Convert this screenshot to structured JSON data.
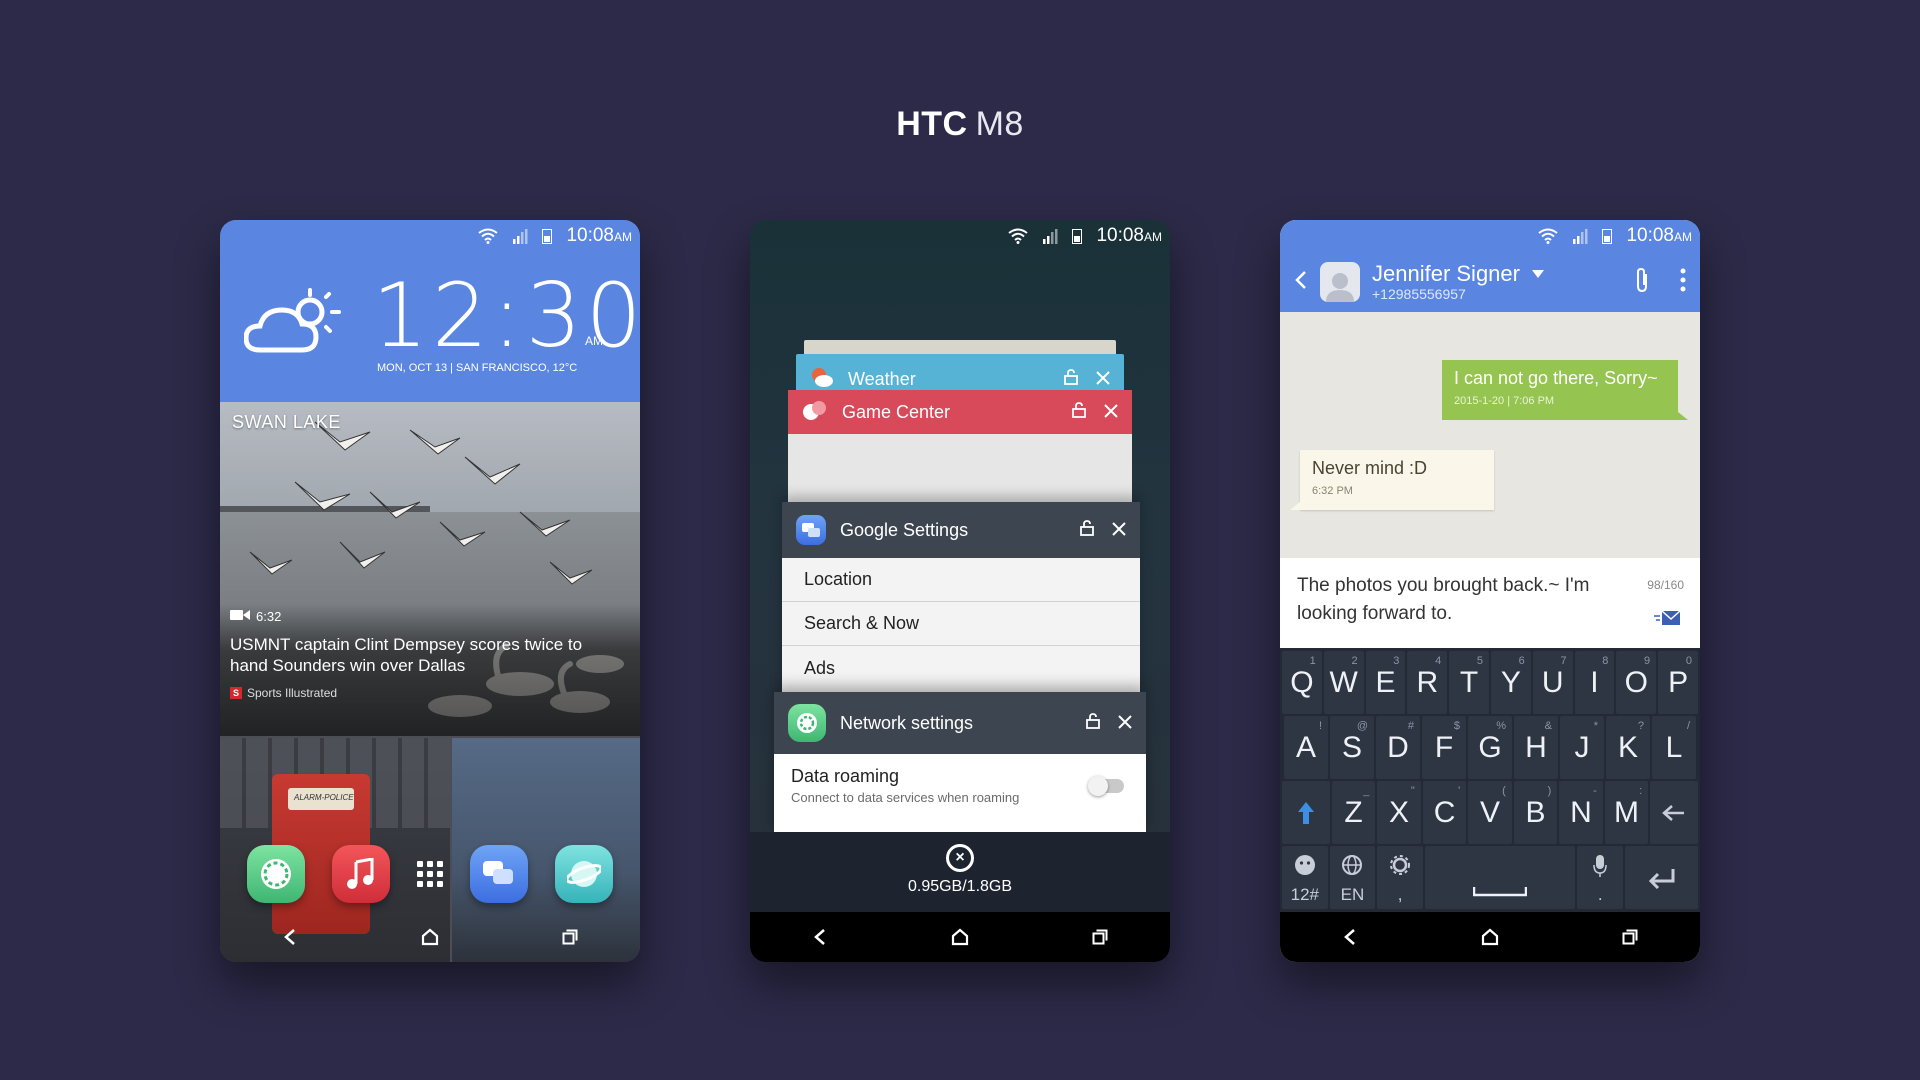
{
  "page": {
    "title_bold": "HTC",
    "title_light": "M8"
  },
  "status": {
    "time": "10:08",
    "ampm": "AM"
  },
  "phone1": {
    "clock": "12:30",
    "clock_ampm": "AM",
    "date_line": "MON, OCT 13 | SAN FRANCISCO, 12°C",
    "news_place": "SWAN LAKE",
    "video_duration": "6:32",
    "headline": "USMNT captain Clint Dempsey scores twice to hand Sounders win over Dallas",
    "source": "Sports Illustrated",
    "alarm_plate": "ALARM-POLICE",
    "dock_apps": [
      "phone-icon",
      "music-icon",
      "app-drawer-icon",
      "messages-icon",
      "browser-icon"
    ]
  },
  "phone2": {
    "cards": {
      "weather": "Weather",
      "game_center": "Game Center",
      "google_settings": "Google Settings",
      "google_items": [
        "Location",
        "Search & Now",
        "Ads"
      ],
      "network": "Network settings",
      "roaming_title": "Data roaming",
      "roaming_sub": "Connect to data services when roaming"
    },
    "roaming_enabled": false,
    "memory": "0.95GB/1.8GB"
  },
  "phone3": {
    "contact_name": "Jennifer Signer",
    "contact_number": "+12985556957",
    "outgoing_text": "I can not go there, Sorry~",
    "outgoing_meta": "2015-1-20  |  7:06 PM",
    "incoming_text": "Never mind  :D",
    "incoming_meta": "6:32 PM",
    "compose_text": "The photos you brought back.~    I'm looking forward to.",
    "char_count": "98/160",
    "keyboard": {
      "row1": [
        [
          "Q",
          "1"
        ],
        [
          "W",
          "2"
        ],
        [
          "E",
          "3"
        ],
        [
          "R",
          "4"
        ],
        [
          "T",
          "5"
        ],
        [
          "Y",
          "6"
        ],
        [
          "U",
          "7"
        ],
        [
          "I",
          "8"
        ],
        [
          "O",
          "9"
        ],
        [
          "P",
          "0"
        ]
      ],
      "row2": [
        [
          "A",
          "!"
        ],
        [
          "S",
          "@"
        ],
        [
          "D",
          "#"
        ],
        [
          "F",
          "$"
        ],
        [
          "G",
          "%"
        ],
        [
          "H",
          "&"
        ],
        [
          "J",
          "*"
        ],
        [
          "K",
          "?"
        ],
        [
          "L",
          "/"
        ]
      ],
      "row3": [
        [
          "Z",
          "_"
        ],
        [
          "X",
          "\""
        ],
        [
          "C",
          "'"
        ],
        [
          "V",
          "("
        ],
        [
          "B",
          ")"
        ],
        [
          "N",
          "-"
        ],
        [
          "M",
          ":"
        ]
      ],
      "sym_label": "12#",
      "lang_label": "EN",
      "comma": ",",
      "period": "."
    }
  },
  "colors": {
    "background": "#2c2a48",
    "accent_blue": "#5a86e1",
    "weather_card": "#57b3d6",
    "game_card": "#d84a5a",
    "outgoing_bubble": "#95c450"
  }
}
